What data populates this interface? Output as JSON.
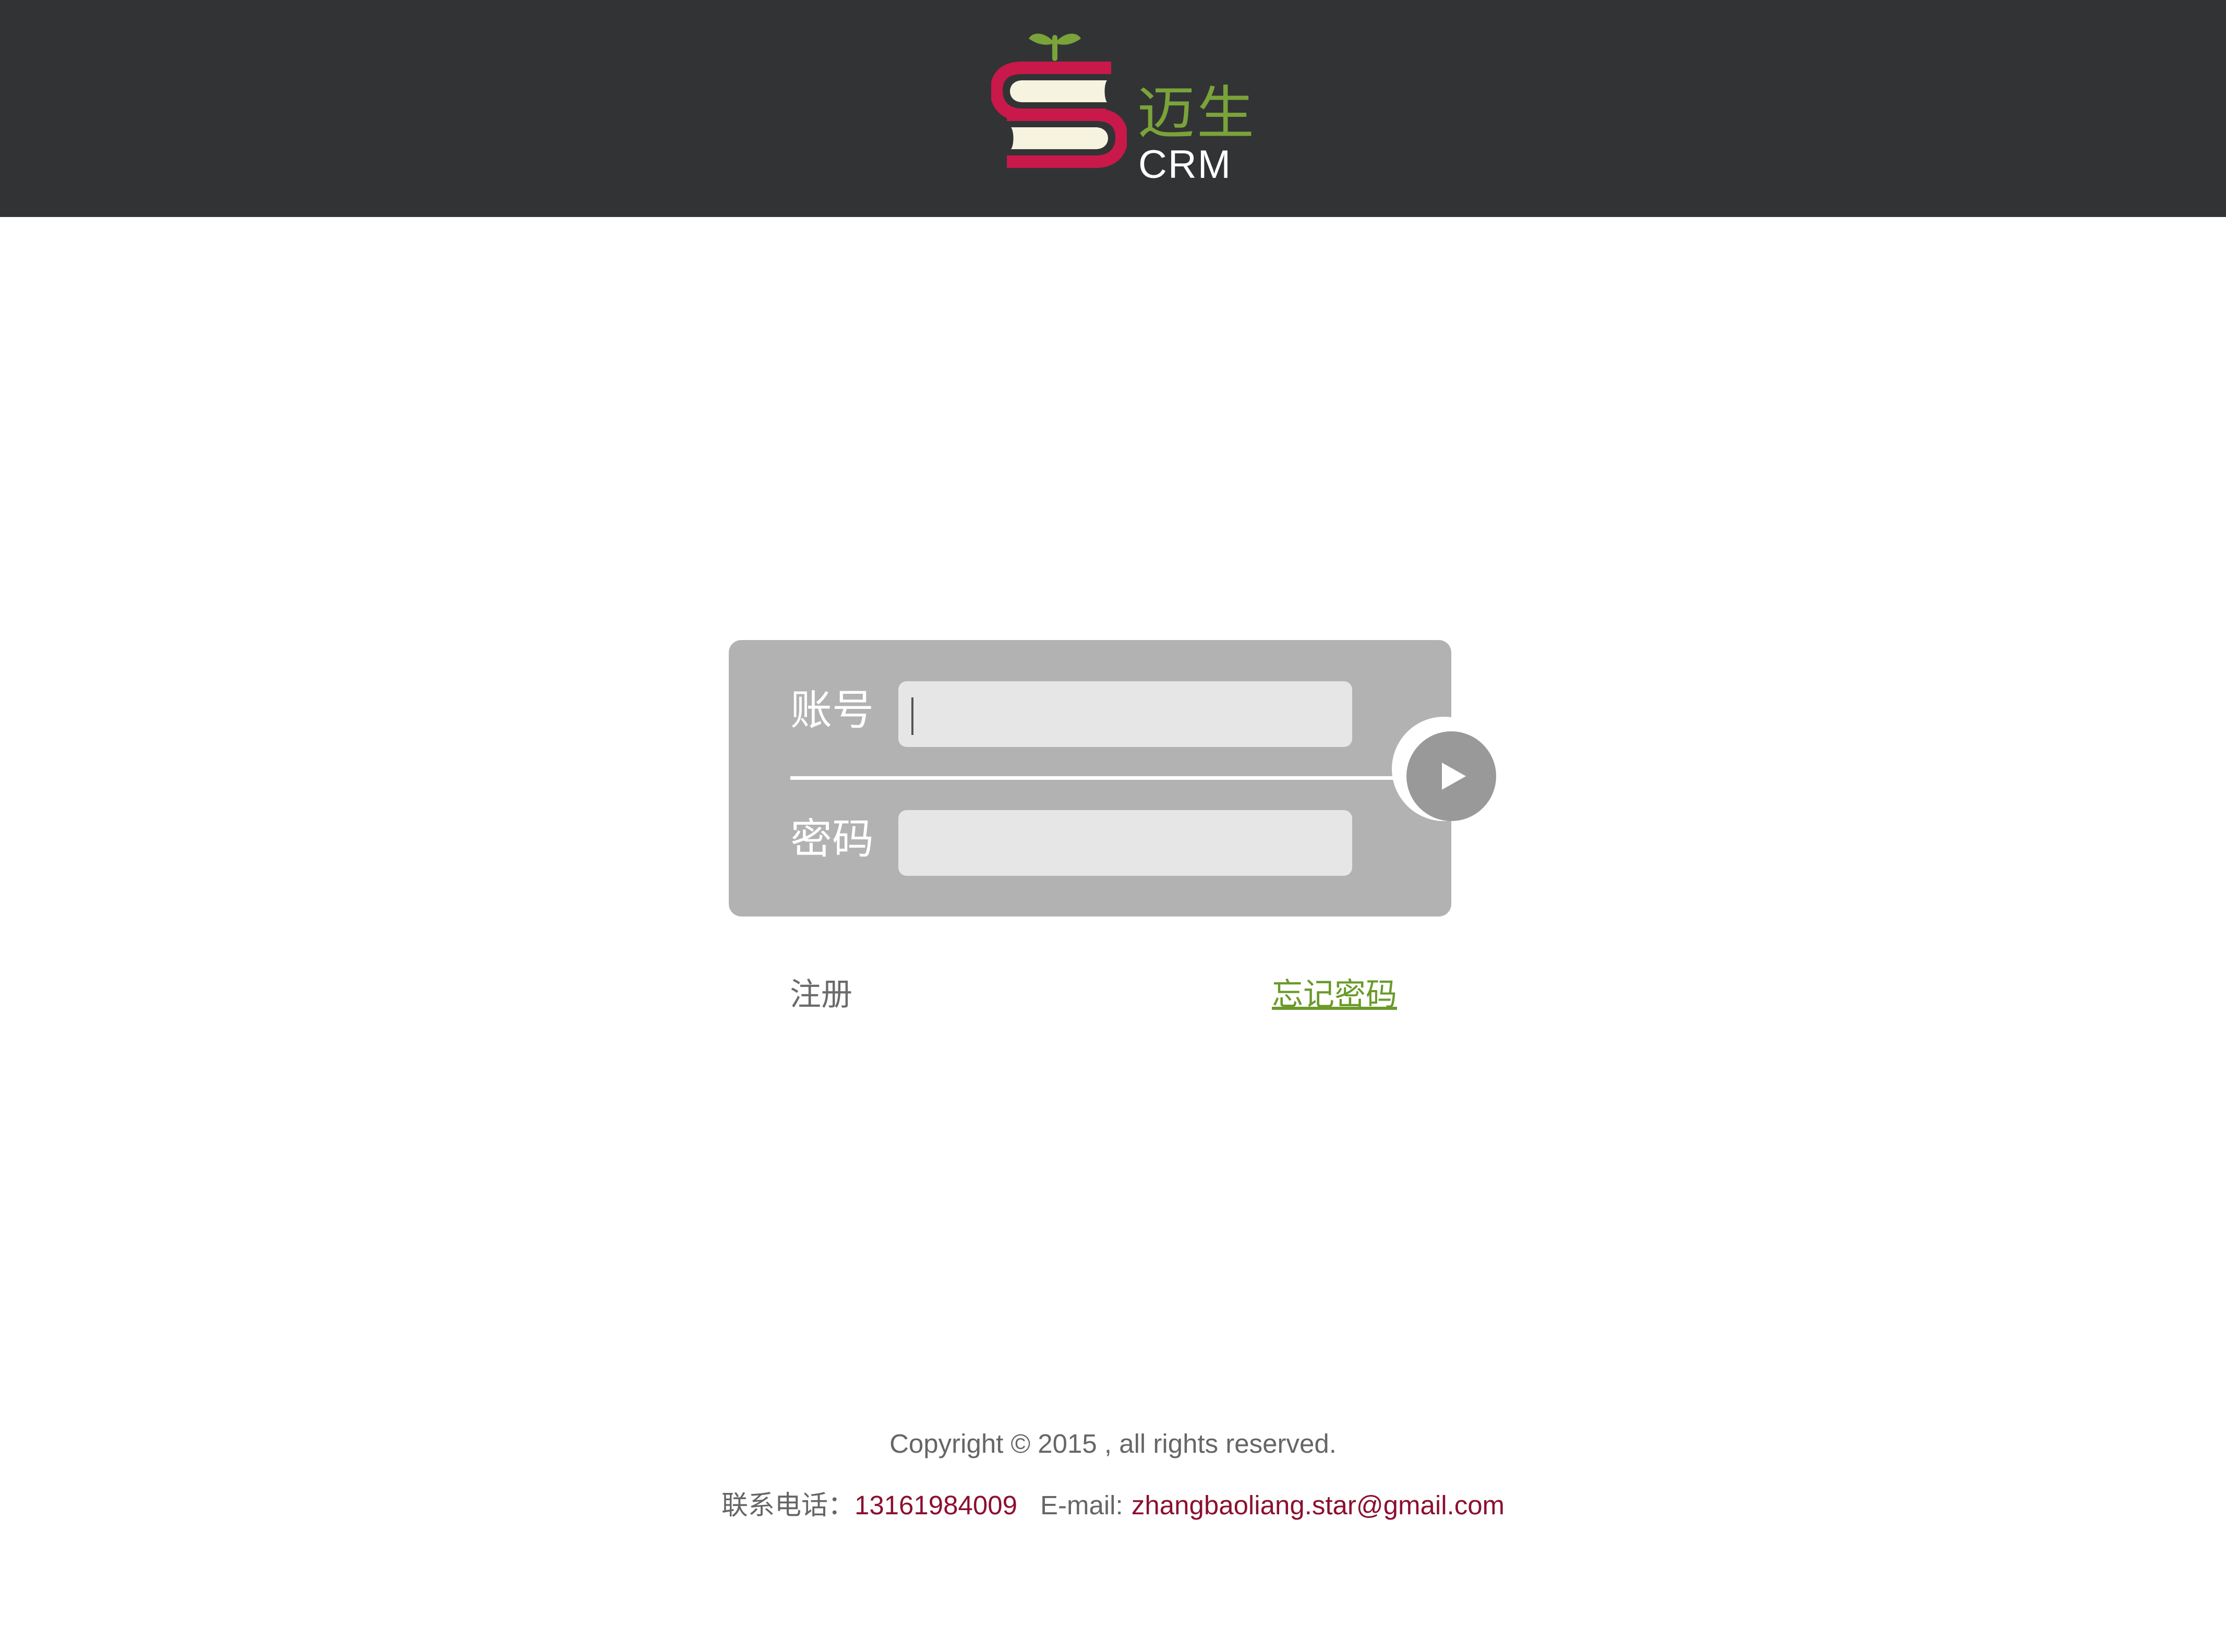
{
  "header": {
    "logo": {
      "icon": "book-stack-sprout-logo",
      "text_cn": "迈生",
      "text_en": "CRM"
    }
  },
  "login_form": {
    "account_label": "账号",
    "password_label": "密码",
    "account_value": "",
    "password_value": "",
    "submit_icon": "play-arrow-icon"
  },
  "links": {
    "register": "注册",
    "forgot_password": "忘记密码"
  },
  "footer": {
    "copyright": "Copyright © 2015 , all rights reserved.",
    "phone_label": "联系电话：",
    "phone": "13161984009",
    "email_label": "E-mail:",
    "email": "zhangbaoliang.star@gmail.com"
  },
  "colors": {
    "header_bg": "#323335",
    "card_bg": "#b2b2b2",
    "input_bg": "#e6e6e6",
    "logo_red": "#c8194a",
    "logo_green": "#7aa33a",
    "link_green": "#6a9a2a",
    "accent_red": "#8b1030"
  }
}
